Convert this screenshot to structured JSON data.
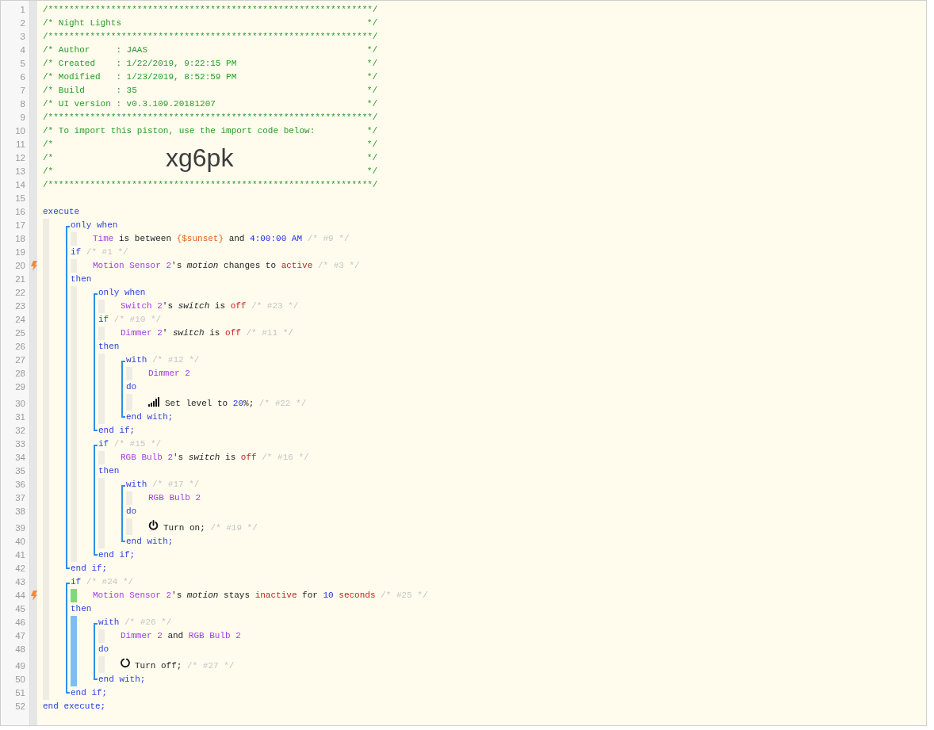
{
  "header": [
    {
      "n": "1",
      "kind": "rule",
      "text": "/**************************************************************/"
    },
    {
      "n": "2",
      "kind": "comment",
      "text": "/* Night Lights",
      "end": "*/"
    },
    {
      "n": "3",
      "kind": "rule",
      "text": "/**************************************************************/"
    },
    {
      "n": "4",
      "kind": "comment",
      "text": "/* Author     : JAAS",
      "end": "*/"
    },
    {
      "n": "5",
      "kind": "comment",
      "text": "/* Created    : 1/22/2019, 9:22:15 PM",
      "end": "*/"
    },
    {
      "n": "6",
      "kind": "comment",
      "text": "/* Modified   : 1/23/2019, 8:52:59 PM",
      "end": "*/"
    },
    {
      "n": "7",
      "kind": "comment",
      "text": "/* Build      : 35",
      "end": "*/"
    },
    {
      "n": "8",
      "kind": "comment",
      "text": "/* UI version : v0.3.109.20181207",
      "end": "*/"
    },
    {
      "n": "9",
      "kind": "rule",
      "text": "/**************************************************************/"
    },
    {
      "n": "10",
      "kind": "comment",
      "text": "/* To import this piston, use the import code below:",
      "end": "*/"
    },
    {
      "n": "11",
      "kind": "comment",
      "text": "/*",
      "end": "*/"
    },
    {
      "n": "12",
      "kind": "code",
      "text": "/*",
      "code": "xg6pk",
      "end": "*/"
    },
    {
      "n": "13",
      "kind": "comment",
      "text": "/*",
      "end": "*/"
    },
    {
      "n": "14",
      "kind": "rule",
      "text": "/**************************************************************/"
    },
    {
      "n": "15",
      "kind": "blank"
    }
  ],
  "code": [
    {
      "kind": "line",
      "n": "16",
      "trigger": false,
      "tokens": [
        {
          "kind": "kw",
          "s": "execute"
        }
      ],
      "color": "#efede3",
      "children": [
        {
          "kind": "block",
          "items": [
            {
              "kind": "line",
              "n": "17",
              "trigger": false,
              "tokens": [
                {
                  "kind": "kw",
                  "s": "only when"
                }
              ],
              "color": "#efede3",
              "children": [
                {
                  "kind": "line",
                  "n": "18",
                  "trigger": false,
                  "tokens": [
                    {
                      "kind": "dev",
                      "s": "Time"
                    },
                    {
                      "kind": "txt",
                      "s": " is between "
                    },
                    {
                      "kind": "var",
                      "s": "{$sunset}"
                    },
                    {
                      "kind": "txt",
                      "s": " and "
                    },
                    {
                      "kind": "num",
                      "s": "4:00:00 AM"
                    },
                    {
                      "kind": "cmt",
                      "s": " /* #9 */"
                    }
                  ]
                }
              ]
            },
            {
              "kind": "line",
              "n": "19",
              "trigger": false,
              "tokens": [
                {
                  "kind": "kw",
                  "s": "if"
                },
                {
                  "kind": "cmt",
                  "s": " /* #1 */"
                }
              ],
              "color": "#efede3",
              "children": [
                {
                  "kind": "line",
                  "n": "20",
                  "trigger": true,
                  "tokens": [
                    {
                      "kind": "dev",
                      "s": "Motion Sensor 2"
                    },
                    {
                      "kind": "txt",
                      "s": "'s "
                    },
                    {
                      "kind": "attr",
                      "s": "motion"
                    },
                    {
                      "kind": "txt",
                      "s": " changes to "
                    },
                    {
                      "kind": "val",
                      "s": "active"
                    },
                    {
                      "kind": "cmt",
                      "s": " /* #3 */"
                    }
                  ]
                }
              ]
            },
            {
              "kind": "line",
              "n": "21",
              "trigger": false,
              "tokens": [
                {
                  "kind": "kw",
                  "s": "then"
                }
              ],
              "color": "#efede3",
              "children": [
                {
                  "kind": "block",
                  "items": [
                    {
                      "kind": "line",
                      "n": "22",
                      "trigger": false,
                      "tokens": [
                        {
                          "kind": "kw",
                          "s": "only when"
                        }
                      ],
                      "color": "#efede3",
                      "children": [
                        {
                          "kind": "line",
                          "n": "23",
                          "trigger": false,
                          "tokens": [
                            {
                              "kind": "dev",
                              "s": "Switch 2"
                            },
                            {
                              "kind": "txt",
                              "s": "'s "
                            },
                            {
                              "kind": "attr",
                              "s": "switch"
                            },
                            {
                              "kind": "txt",
                              "s": " is "
                            },
                            {
                              "kind": "val",
                              "s": "off"
                            },
                            {
                              "kind": "cmt",
                              "s": " /* #23 */"
                            }
                          ]
                        }
                      ]
                    },
                    {
                      "kind": "line",
                      "n": "24",
                      "trigger": false,
                      "tokens": [
                        {
                          "kind": "kw",
                          "s": "if"
                        },
                        {
                          "kind": "cmt",
                          "s": " /* #10 */"
                        }
                      ],
                      "color": "#efede3",
                      "children": [
                        {
                          "kind": "line",
                          "n": "25",
                          "trigger": false,
                          "tokens": [
                            {
                              "kind": "dev",
                              "s": "Dimmer 2"
                            },
                            {
                              "kind": "txt",
                              "s": "' "
                            },
                            {
                              "kind": "attr",
                              "s": "switch"
                            },
                            {
                              "kind": "txt",
                              "s": " is "
                            },
                            {
                              "kind": "val",
                              "s": "off"
                            },
                            {
                              "kind": "cmt",
                              "s": " /* #11 */"
                            }
                          ]
                        }
                      ]
                    },
                    {
                      "kind": "line",
                      "n": "26",
                      "trigger": false,
                      "tokens": [
                        {
                          "kind": "kw",
                          "s": "then"
                        }
                      ],
                      "color": "#efede3",
                      "children": [
                        {
                          "kind": "block",
                          "items": [
                            {
                              "kind": "line",
                              "n": "27",
                              "trigger": false,
                              "tokens": [
                                {
                                  "kind": "kw",
                                  "s": "with"
                                },
                                {
                                  "kind": "cmt",
                                  "s": " /* #12 */"
                                }
                              ],
                              "color": "#efede3",
                              "children": [
                                {
                                  "kind": "line",
                                  "n": "28",
                                  "trigger": false,
                                  "tokens": [
                                    {
                                      "kind": "dev",
                                      "s": "Dimmer 2"
                                    }
                                  ]
                                }
                              ]
                            },
                            {
                              "kind": "line",
                              "n": "29",
                              "trigger": false,
                              "tokens": [
                                {
                                  "kind": "kw",
                                  "s": "do"
                                }
                              ],
                              "color": "#efede3",
                              "children": [
                                {
                                  "kind": "line",
                                  "n": "30",
                                  "trigger": false,
                                  "tokens": [
                                    {
                                      "kind": "signal"
                                    },
                                    {
                                      "kind": "txt",
                                      "s": "Set level to "
                                    },
                                    {
                                      "kind": "num",
                                      "s": "20"
                                    },
                                    {
                                      "kind": "txt",
                                      "s": "%;"
                                    },
                                    {
                                      "kind": "cmt",
                                      "s": " /* #22 */"
                                    }
                                  ]
                                }
                              ]
                            },
                            {
                              "kind": "line",
                              "n": "31",
                              "trigger": false,
                              "tokens": [
                                {
                                  "kind": "kw",
                                  "s": "end with;"
                                }
                              ]
                            }
                          ]
                        }
                      ]
                    },
                    {
                      "kind": "line",
                      "n": "32",
                      "trigger": false,
                      "tokens": [
                        {
                          "kind": "kw",
                          "s": "end if;"
                        }
                      ]
                    }
                  ]
                },
                {
                  "kind": "block",
                  "items": [
                    {
                      "kind": "line",
                      "n": "33",
                      "trigger": false,
                      "tokens": [
                        {
                          "kind": "kw",
                          "s": "if"
                        },
                        {
                          "kind": "cmt",
                          "s": " /* #15 */"
                        }
                      ],
                      "color": "#efede3",
                      "children": [
                        {
                          "kind": "line",
                          "n": "34",
                          "trigger": false,
                          "tokens": [
                            {
                              "kind": "dev",
                              "s": "RGB Bulb 2"
                            },
                            {
                              "kind": "txt",
                              "s": "'s "
                            },
                            {
                              "kind": "attr",
                              "s": "switch"
                            },
                            {
                              "kind": "txt",
                              "s": " is "
                            },
                            {
                              "kind": "val",
                              "s": "off"
                            },
                            {
                              "kind": "cmt",
                              "s": " /* #16 */"
                            }
                          ]
                        }
                      ]
                    },
                    {
                      "kind": "line",
                      "n": "35",
                      "trigger": false,
                      "tokens": [
                        {
                          "kind": "kw",
                          "s": "then"
                        }
                      ],
                      "color": "#efede3",
                      "children": [
                        {
                          "kind": "block",
                          "items": [
                            {
                              "kind": "line",
                              "n": "36",
                              "trigger": false,
                              "tokens": [
                                {
                                  "kind": "kw",
                                  "s": "with"
                                },
                                {
                                  "kind": "cmt",
                                  "s": " /* #17 */"
                                }
                              ],
                              "color": "#efede3",
                              "children": [
                                {
                                  "kind": "line",
                                  "n": "37",
                                  "trigger": false,
                                  "tokens": [
                                    {
                                      "kind": "dev",
                                      "s": "RGB Bulb 2"
                                    }
                                  ]
                                }
                              ]
                            },
                            {
                              "kind": "line",
                              "n": "38",
                              "trigger": false,
                              "tokens": [
                                {
                                  "kind": "kw",
                                  "s": "do"
                                }
                              ],
                              "color": "#efede3",
                              "children": [
                                {
                                  "kind": "line",
                                  "n": "39",
                                  "trigger": false,
                                  "tokens": [
                                    {
                                      "kind": "power"
                                    },
                                    {
                                      "kind": "txt",
                                      "s": "Turn on;"
                                    },
                                    {
                                      "kind": "cmt",
                                      "s": " /* #19 */"
                                    }
                                  ]
                                }
                              ]
                            },
                            {
                              "kind": "line",
                              "n": "40",
                              "trigger": false,
                              "tokens": [
                                {
                                  "kind": "kw",
                                  "s": "end with;"
                                }
                              ]
                            }
                          ]
                        }
                      ]
                    },
                    {
                      "kind": "line",
                      "n": "41",
                      "trigger": false,
                      "tokens": [
                        {
                          "kind": "kw",
                          "s": "end if;"
                        }
                      ]
                    }
                  ]
                }
              ]
            },
            {
              "kind": "line",
              "n": "42",
              "trigger": false,
              "tokens": [
                {
                  "kind": "kw",
                  "s": "end if;"
                }
              ]
            }
          ]
        },
        {
          "kind": "block",
          "items": [
            {
              "kind": "line",
              "n": "43",
              "trigger": false,
              "tokens": [
                {
                  "kind": "kw",
                  "s": "if"
                },
                {
                  "kind": "cmt",
                  "s": " /* #24 */"
                }
              ],
              "color": "#7ed87e",
              "children": [
                {
                  "kind": "line",
                  "n": "44",
                  "trigger": true,
                  "tokens": [
                    {
                      "kind": "dev",
                      "s": "Motion Sensor 2"
                    },
                    {
                      "kind": "txt",
                      "s": "'s "
                    },
                    {
                      "kind": "attr",
                      "s": "motion"
                    },
                    {
                      "kind": "txt",
                      "s": " stays "
                    },
                    {
                      "kind": "val",
                      "s": "inactive"
                    },
                    {
                      "kind": "txt",
                      "s": " for "
                    },
                    {
                      "kind": "num",
                      "s": "10"
                    },
                    {
                      "kind": "val",
                      "s": " seconds"
                    },
                    {
                      "kind": "cmt",
                      "s": " /* #25 */"
                    }
                  ]
                }
              ]
            },
            {
              "kind": "line",
              "n": "45",
              "trigger": false,
              "tokens": [
                {
                  "kind": "kw",
                  "s": "then"
                }
              ],
              "color": "#80bcf4",
              "children": [
                {
                  "kind": "block",
                  "items": [
                    {
                      "kind": "line",
                      "n": "46",
                      "trigger": false,
                      "tokens": [
                        {
                          "kind": "kw",
                          "s": "with"
                        },
                        {
                          "kind": "cmt",
                          "s": " /* #26 */"
                        }
                      ],
                      "color": "#efede3",
                      "children": [
                        {
                          "kind": "line",
                          "n": "47",
                          "trigger": false,
                          "tokens": [
                            {
                              "kind": "dev",
                              "s": "Dimmer 2"
                            },
                            {
                              "kind": "txt",
                              "s": " and "
                            },
                            {
                              "kind": "dev",
                              "s": "RGB Bulb 2"
                            }
                          ]
                        }
                      ]
                    },
                    {
                      "kind": "line",
                      "n": "48",
                      "trigger": false,
                      "tokens": [
                        {
                          "kind": "kw",
                          "s": "do"
                        }
                      ],
                      "color": "#efede3",
                      "children": [
                        {
                          "kind": "line",
                          "n": "49",
                          "trigger": false,
                          "tokens": [
                            {
                              "kind": "ring"
                            },
                            {
                              "kind": "txt",
                              "s": "Turn off;"
                            },
                            {
                              "kind": "cmt",
                              "s": " /* #27 */"
                            }
                          ]
                        }
                      ]
                    },
                    {
                      "kind": "line",
                      "n": "50",
                      "trigger": false,
                      "tokens": [
                        {
                          "kind": "kw",
                          "s": "end with;"
                        }
                      ]
                    }
                  ]
                }
              ]
            },
            {
              "kind": "line",
              "n": "51",
              "trigger": false,
              "tokens": [
                {
                  "kind": "kw",
                  "s": "end if;"
                }
              ]
            }
          ]
        }
      ]
    },
    {
      "kind": "line",
      "n": "52",
      "trigger": false,
      "tokens": [
        {
          "kind": "kw",
          "s": "end execute;"
        }
      ]
    }
  ]
}
